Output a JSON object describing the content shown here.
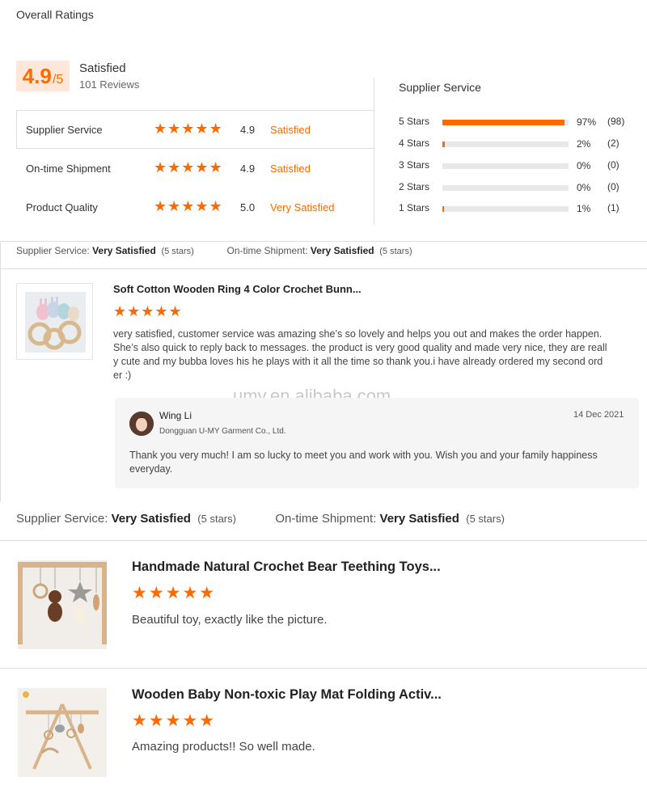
{
  "overall": {
    "title": "Overall Ratings",
    "score": "4.9",
    "score_out_of": "/5",
    "label": "Satisfied",
    "reviews": "101 Reviews"
  },
  "criteria": [
    {
      "name": "Supplier Service",
      "stars": "★★★★★",
      "score": "4.9",
      "level": "Satisfied"
    },
    {
      "name": "On-time Shipment",
      "stars": "★★★★★",
      "score": "4.9",
      "level": "Satisfied"
    },
    {
      "name": "Product Quality",
      "stars": "★★★★★",
      "score": "5.0",
      "level": "Very Satisfied"
    }
  ],
  "supplier_service": {
    "title": "Supplier Service",
    "rows": [
      {
        "label": "5 Stars",
        "pct": "97%",
        "fraction": 0.97,
        "count": "(98)"
      },
      {
        "label": "4 Stars",
        "pct": "2%",
        "fraction": 0.02,
        "count": "(2)"
      },
      {
        "label": "3 Stars",
        "pct": "0%",
        "fraction": 0,
        "count": "(0)"
      },
      {
        "label": "2 Stars",
        "pct": "0%",
        "fraction": 0,
        "count": "(0)"
      },
      {
        "label": "1 Stars",
        "pct": "1%",
        "fraction": 0.01,
        "count": "(1)"
      }
    ]
  },
  "review1": {
    "supplier_label": "Supplier Service:",
    "supplier_value": "Very Satisfied",
    "supplier_stars": "(5 stars)",
    "shipment_label": "On-time Shipment:",
    "shipment_value": "Very Satisfied",
    "shipment_stars": "(5 stars)",
    "product_title": "Soft Cotton Wooden Ring 4 Color Crochet Bunn...",
    "stars": "★★★★★",
    "text": "very satisfied, customer service was amazing she’s so lovely and helps you out and makes the order happen. She’s also quick to reply back to messages. the product is very good quality and made very nice, they are really cute and my bubba loves his he plays with it all the time so thank you.i have already ordered my second order :)",
    "reply": {
      "name": "Wing Li",
      "company": "Dongguan U-MY Garment Co., Ltd.",
      "date": "14 Dec 2021",
      "text": "Thank you very much!   I am so lucky to meet you and work with you. Wish you and your family happiness everyday."
    }
  },
  "watermark": "umy.en.alibaba.com",
  "review2": {
    "supplier_label": "Supplier Service:",
    "supplier_value": "Very Satisfied",
    "supplier_stars": "(5 stars)",
    "shipment_label": "On-time Shipment:",
    "shipment_value": "Very Satisfied",
    "shipment_stars": "(5 stars)",
    "product_title": "Handmade Natural Crochet Bear Teething Toys...",
    "stars": "★★★★★",
    "text": "Beautiful toy, exactly like the picture."
  },
  "review3": {
    "product_title": "Wooden Baby Non-toxic Play Mat Folding Activ...",
    "stars": "★★★★★",
    "text": "Amazing products!! So well made."
  },
  "colors": {
    "accent": "#ff6a00",
    "score_bg": "#ffe8d9"
  }
}
